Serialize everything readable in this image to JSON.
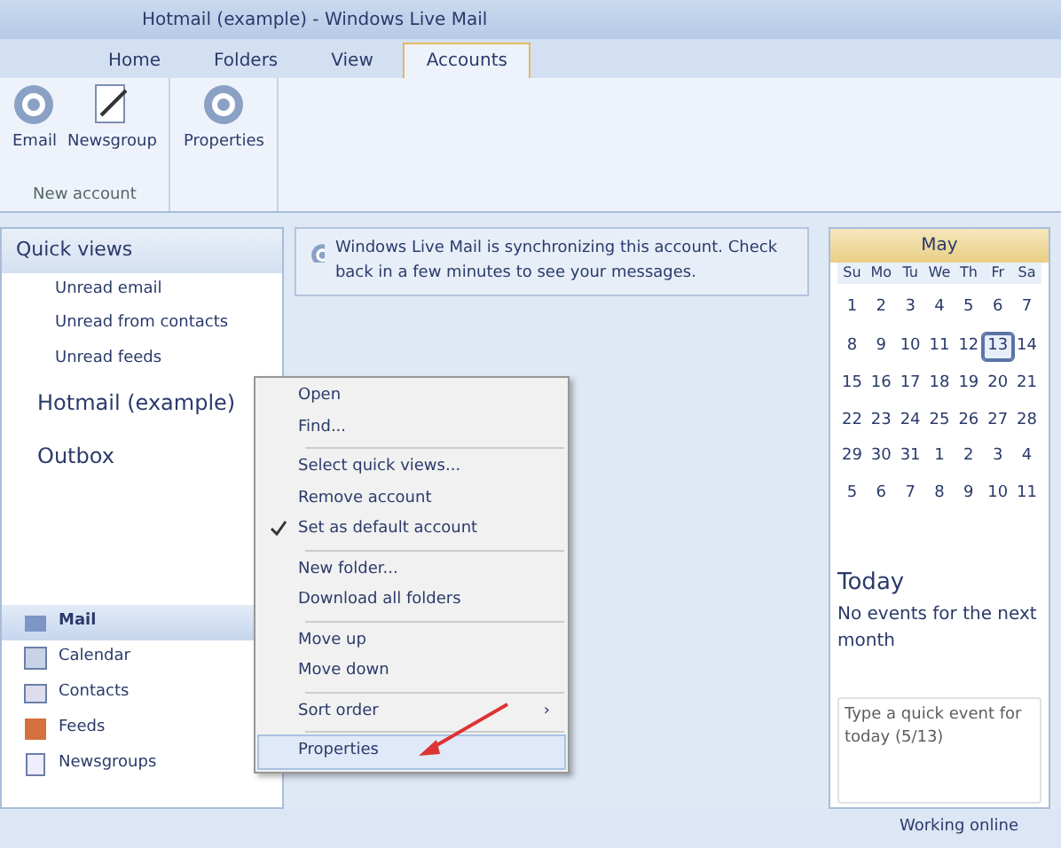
{
  "window": {
    "title": "Hotmail (example) - Windows Live Mail"
  },
  "tabs": [
    {
      "label": "Home",
      "selected": false
    },
    {
      "label": "Folders",
      "selected": false
    },
    {
      "label": "View",
      "selected": false
    },
    {
      "label": "Accounts",
      "selected": true
    }
  ],
  "ribbon": {
    "buttons": [
      {
        "label": "Email",
        "kind": "at"
      },
      {
        "label": "Newsgroup",
        "kind": "pen"
      },
      {
        "label": "Properties",
        "kind": "at"
      }
    ],
    "group_label": "New account"
  },
  "sidebar": {
    "items": [
      {
        "label": "Quick views",
        "kind": "header"
      },
      {
        "label": "Unread email",
        "kind": "sub"
      },
      {
        "label": "Unread from contacts",
        "kind": "sub"
      },
      {
        "label": "Unread feeds",
        "kind": "sub"
      },
      {
        "label": "Hotmail (example)",
        "kind": "account"
      },
      {
        "label": "Outbox",
        "kind": "account"
      }
    ],
    "nav": [
      {
        "label": "Mail",
        "selected": true
      },
      {
        "label": "Calendar",
        "selected": false
      },
      {
        "label": "Contacts",
        "selected": false
      },
      {
        "label": "Feeds",
        "selected": false
      },
      {
        "label": "Newsgroups",
        "selected": false
      }
    ]
  },
  "notice": "Windows Live Mail is synchronizing this account. Check back in a few minutes to see your messages.",
  "context_menu": [
    {
      "label": "Open",
      "checked": false,
      "selected": false
    },
    {
      "label": "Find...",
      "checked": false,
      "selected": false
    },
    {
      "label": "Select quick views...",
      "checked": false,
      "selected": false,
      "separator_before": true
    },
    {
      "label": "Remove account",
      "checked": false,
      "selected": false
    },
    {
      "label": "Set as default account",
      "checked": true,
      "selected": false
    },
    {
      "label": "New folder...",
      "checked": false,
      "selected": false,
      "separator_before": true
    },
    {
      "label": "Download all folders",
      "checked": false,
      "selected": false
    },
    {
      "label": "Move up",
      "checked": false,
      "selected": false,
      "separator_before": true
    },
    {
      "label": "Move down",
      "checked": false,
      "selected": false
    },
    {
      "label": "Sort order",
      "checked": false,
      "selected": false,
      "separator_before": true,
      "submenu": "›"
    },
    {
      "label": "Properties",
      "checked": false,
      "selected": true,
      "separator_before": true
    }
  ],
  "calendar": {
    "month": "May",
    "weekdays": [
      "Su",
      "Mo",
      "Tu",
      "We",
      "Th",
      "Fr",
      "Sa"
    ],
    "weeks": [
      {
        "days": [
          {
            "label": "1",
            "selected": false
          },
          {
            "label": "2",
            "selected": false
          },
          {
            "label": "3",
            "selected": false
          },
          {
            "label": "4",
            "selected": false
          },
          {
            "label": "5",
            "selected": false
          },
          {
            "label": "6",
            "selected": false
          },
          {
            "label": "7",
            "selected": false
          }
        ]
      },
      {
        "days": [
          {
            "label": "8",
            "selected": false
          },
          {
            "label": "9",
            "selected": false
          },
          {
            "label": "10",
            "selected": false
          },
          {
            "label": "11",
            "selected": false
          },
          {
            "label": "12",
            "selected": false
          },
          {
            "label": "13",
            "selected": true
          },
          {
            "label": "14",
            "selected": false
          }
        ]
      },
      {
        "days": [
          {
            "label": "15",
            "selected": false
          },
          {
            "label": "16",
            "selected": false
          },
          {
            "label": "17",
            "selected": false
          },
          {
            "label": "18",
            "selected": false
          },
          {
            "label": "19",
            "selected": false
          },
          {
            "label": "20",
            "selected": false
          },
          {
            "label": "21",
            "selected": false
          }
        ]
      },
      {
        "days": [
          {
            "label": "22",
            "selected": false
          },
          {
            "label": "23",
            "selected": false
          },
          {
            "label": "24",
            "selected": false
          },
          {
            "label": "25",
            "selected": false
          },
          {
            "label": "26",
            "selected": false
          },
          {
            "label": "27",
            "selected": false
          },
          {
            "label": "28",
            "selected": false
          }
        ]
      },
      {
        "days": [
          {
            "label": "29",
            "selected": false
          },
          {
            "label": "30",
            "selected": false
          },
          {
            "label": "31",
            "selected": false
          },
          {
            "label": "1",
            "selected": false
          },
          {
            "label": "2",
            "selected": false
          },
          {
            "label": "3",
            "selected": false
          },
          {
            "label": "4",
            "selected": false
          }
        ]
      },
      {
        "days": [
          {
            "label": "5",
            "selected": false
          },
          {
            "label": "6",
            "selected": false
          },
          {
            "label": "7",
            "selected": false
          },
          {
            "label": "8",
            "selected": false
          },
          {
            "label": "9",
            "selected": false
          },
          {
            "label": "10",
            "selected": false
          },
          {
            "label": "11",
            "selected": false
          }
        ]
      }
    ],
    "today_title": "Today",
    "today_text": "No events for the next month",
    "quick_event_placeholder": "Type a quick event for today (5/13)"
  },
  "status_bar": "Working online"
}
